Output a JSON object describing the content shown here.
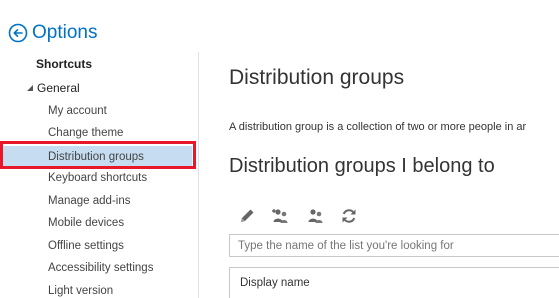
{
  "header": {
    "title": "Options",
    "back_icon": "back-arrow-circle-icon",
    "accent_color": "#0072c6"
  },
  "sidebar": {
    "shortcuts_label": "Shortcuts",
    "general_label": "General",
    "items": [
      {
        "label": "My account"
      },
      {
        "label": "Change theme"
      },
      {
        "label": "Distribution groups",
        "selected": true
      },
      {
        "label": "Keyboard shortcuts"
      },
      {
        "label": "Manage add-ins"
      },
      {
        "label": "Mobile devices"
      },
      {
        "label": "Offline settings"
      },
      {
        "label": "Accessibility settings"
      },
      {
        "label": "Light version"
      }
    ],
    "selected_bg": "#c6dcf1",
    "highlight_color": "#e8182a"
  },
  "main": {
    "title": "Distribution groups",
    "description": "A distribution group is a collection of two or more people in ar",
    "section_title": "Distribution groups I belong to",
    "toolbar": [
      {
        "icon": "edit-pencil-icon"
      },
      {
        "icon": "join-group-icon"
      },
      {
        "icon": "leave-group-icon"
      },
      {
        "icon": "refresh-icon"
      }
    ],
    "search": {
      "placeholder": "Type the name of the list you're looking for",
      "value": ""
    },
    "list_header": "Display name"
  }
}
